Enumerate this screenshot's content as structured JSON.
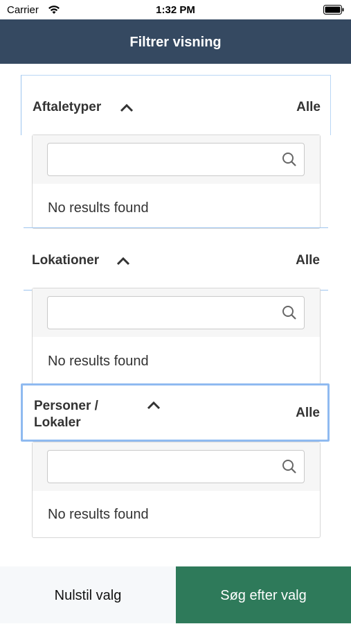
{
  "status_bar": {
    "carrier": "Carrier",
    "time": "1:32 PM",
    "icons": [
      "wifi-icon",
      "battery-icon"
    ]
  },
  "nav": {
    "title": "Filtrer visning"
  },
  "sections": [
    {
      "title": "Aftaletyper",
      "selected": "Alle",
      "search_placeholder": "",
      "empty_text": "No results found",
      "icon": "chevron-up-icon"
    },
    {
      "title": "Lokationer",
      "selected": "Alle",
      "search_placeholder": "",
      "empty_text": "No results found",
      "icon": "chevron-up-icon"
    },
    {
      "title_line1": "Personer /",
      "title_line2": "Lokaler",
      "selected": "Alle",
      "search_placeholder": "",
      "empty_text": "No results found",
      "icon": "chevron-up-icon"
    }
  ],
  "footer": {
    "reset_label": "Nulstil valg",
    "search_label": "Søg efter valg"
  },
  "colors": {
    "nav_bg": "#354961",
    "primary_button": "#2e7a5a",
    "focus_border": "#8fbaf0"
  }
}
